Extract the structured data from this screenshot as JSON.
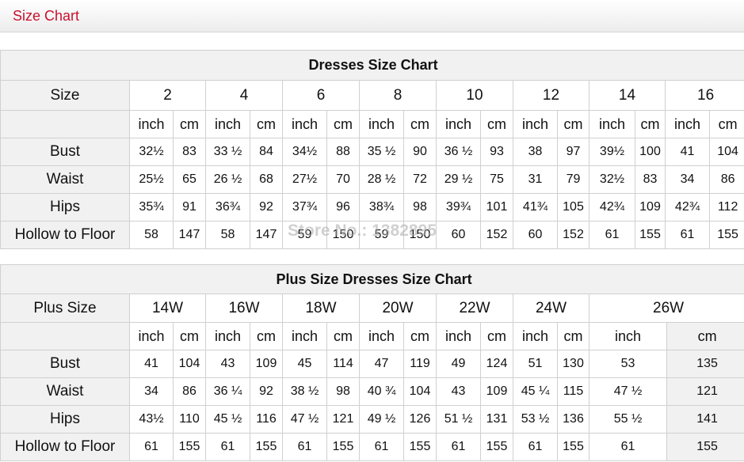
{
  "header": {
    "title": "Size Chart"
  },
  "watermark": "Store No.: 1382895",
  "table1": {
    "title": "Dresses Size Chart",
    "size_label": "Size",
    "sizes": [
      "2",
      "4",
      "6",
      "8",
      "10",
      "12",
      "14",
      "16"
    ],
    "unit_inch": "inch",
    "unit_cm": "cm",
    "rows": [
      {
        "label": "Bust",
        "values": [
          "32½",
          "83",
          "33 ½",
          "84",
          "34½",
          "88",
          "35 ½",
          "90",
          "36 ½",
          "93",
          "38",
          "97",
          "39½",
          "100",
          "41",
          "104"
        ]
      },
      {
        "label": "Waist",
        "values": [
          "25½",
          "65",
          "26 ½",
          "68",
          "27½",
          "70",
          "28 ½",
          "72",
          "29 ½",
          "75",
          "31",
          "79",
          "32½",
          "83",
          "34",
          "86"
        ]
      },
      {
        "label": "Hips",
        "values": [
          "35¾",
          "91",
          "36¾",
          "92",
          "37¾",
          "96",
          "38¾",
          "98",
          "39¾",
          "101",
          "41¾",
          "105",
          "42¾",
          "109",
          "42¾",
          "112"
        ]
      },
      {
        "label": "Hollow to Floor",
        "values": [
          "58",
          "147",
          "58",
          "147",
          "59",
          "150",
          "59",
          "150",
          "60",
          "152",
          "60",
          "152",
          "61",
          "155",
          "61",
          "155"
        ]
      }
    ]
  },
  "table2": {
    "title": "Plus Size Dresses Size Chart",
    "size_label": "Plus Size",
    "sizes": [
      "14W",
      "16W",
      "18W",
      "20W",
      "22W",
      "24W",
      "26W"
    ],
    "unit_inch": "inch",
    "unit_cm": "cm",
    "rows": [
      {
        "label": "Bust",
        "values": [
          "41",
          "104",
          "43",
          "109",
          "45",
          "114",
          "47",
          "119",
          "49",
          "124",
          "51",
          "130",
          "53",
          "135"
        ]
      },
      {
        "label": "Waist",
        "values": [
          "34",
          "86",
          "36 ¼",
          "92",
          "38 ½",
          "98",
          "40 ¾",
          "104",
          "43",
          "109",
          "45 ¼",
          "115",
          "47 ½",
          "121"
        ]
      },
      {
        "label": "Hips",
        "values": [
          "43½",
          "110",
          "45 ½",
          "116",
          "47 ½",
          "121",
          "49 ½",
          "126",
          "51 ½",
          "131",
          "53 ½",
          "136",
          "55 ½",
          "141"
        ]
      },
      {
        "label": "Hollow to Floor",
        "values": [
          "61",
          "155",
          "61",
          "155",
          "61",
          "155",
          "61",
          "155",
          "61",
          "155",
          "61",
          "155",
          "61",
          "155"
        ]
      }
    ]
  }
}
